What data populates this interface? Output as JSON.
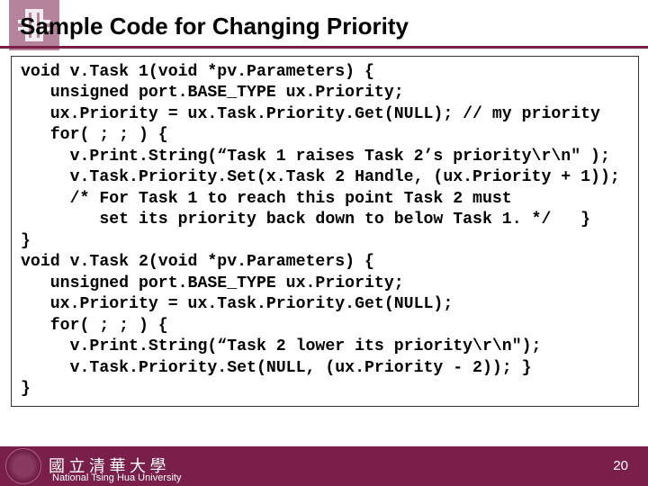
{
  "title": "Sample Code for Changing Priority",
  "code": "void v.Task 1(void *pv.Parameters) {\n   unsigned port.BASE_TYPE ux.Priority;\n   ux.Priority = ux.Task.Priority.Get(NULL); // my priority\n   for( ; ; ) {\n     v.Print.String(“Task 1 raises Task 2’s priority\\r\\n\" );\n     v.Task.Priority.Set(x.Task 2 Handle, (ux.Priority + 1));\n     /* For Task 1 to reach this point Task 2 must\n        set its priority back down to below Task 1. */   }\n}\nvoid v.Task 2(void *pv.Parameters) {\n   unsigned port.BASE_TYPE ux.Priority;\n   ux.Priority = ux.Task.Priority.Get(NULL);\n   for( ; ; ) {\n     v.Print.String(“Task 2 lower its priority\\r\\n\");\n     v.Task.Priority.Set(NULL, (ux.Priority - 2)); }\n}",
  "footer": {
    "university": "National Tsing Hua University",
    "page": "20"
  }
}
